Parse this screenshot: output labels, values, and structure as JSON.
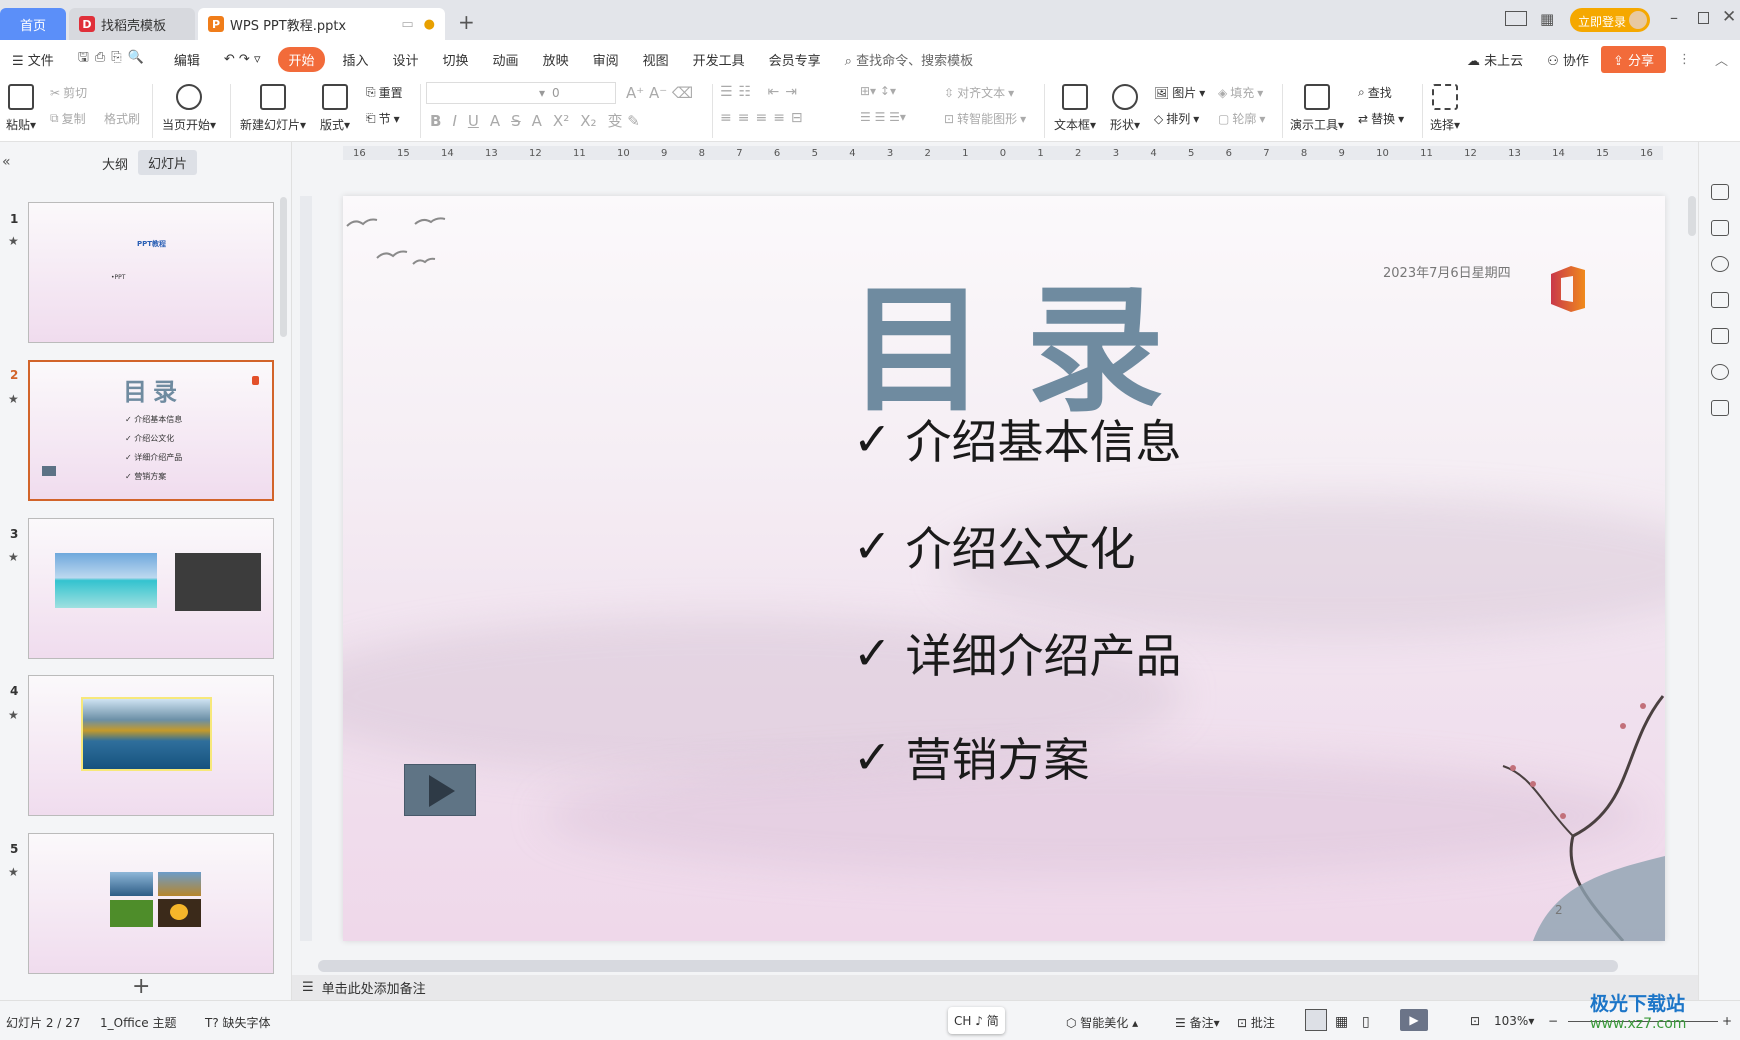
{
  "titlebar": {
    "tabs": [
      {
        "label": "首页"
      },
      {
        "label": "找稻壳模板"
      },
      {
        "label": "WPS PPT教程.pptx"
      }
    ],
    "new_tab": "+",
    "login": "立即登录",
    "colors": {
      "home_tab": "#5b8ff9",
      "accent": "#f26b3a",
      "login": "#f5a800"
    }
  },
  "menubar": {
    "file": "文件",
    "edit": "编辑",
    "tabs": [
      "开始",
      "插入",
      "设计",
      "切换",
      "动画",
      "放映",
      "审阅",
      "视图",
      "开发工具",
      "会员专享"
    ],
    "active": "开始",
    "search_placeholder": "查找命令、搜索模板",
    "cloud": "未上云",
    "collab": "协作",
    "share": "分享"
  },
  "ribbon": {
    "paste": "粘贴",
    "cut": "剪切",
    "copy": "复制",
    "format_painter": "格式刷",
    "play_current": "当页开始",
    "new_slide": "新建幻灯片",
    "layout": "版式",
    "reset": "重置",
    "section": "节",
    "font_size": "0",
    "align_text": "对齐文本",
    "smartart": "转智能图形",
    "textbox": "文本框",
    "shape": "形状",
    "picture": "图片",
    "fill": "填充",
    "arrange": "排列",
    "outline": "轮廓",
    "present_tools": "演示工具",
    "find": "查找",
    "replace": "替换",
    "select": "选择",
    "format_buttons": [
      "B",
      "I",
      "U",
      "A",
      "S",
      "A",
      "X²",
      "X₂"
    ]
  },
  "leftpanel": {
    "tab_outline": "大纲",
    "tab_slides": "幻灯片",
    "add": "+",
    "slides": [
      {
        "num": "1",
        "title": "PPT教程",
        "sub": "•PPT"
      },
      {
        "num": "2",
        "title": "目录",
        "items": [
          "✓ 介绍基本信息",
          "✓ 介绍公文化",
          "✓ 详细介绍产品",
          "✓ 营销方案"
        ]
      },
      {
        "num": "3"
      },
      {
        "num": "4"
      },
      {
        "num": "5"
      }
    ],
    "selected": 2
  },
  "ruler": {
    "ticks": [
      "16",
      "15",
      "14",
      "13",
      "12",
      "11",
      "10",
      "9",
      "8",
      "7",
      "6",
      "5",
      "4",
      "3",
      "2",
      "1",
      "0",
      "1",
      "2",
      "3",
      "4",
      "5",
      "6",
      "7",
      "8",
      "9",
      "10",
      "11",
      "12",
      "13",
      "14",
      "15",
      "16"
    ]
  },
  "slide": {
    "title": "目录",
    "date": "2023年7月6日星期四",
    "bullets": [
      "介绍基本信息",
      "介绍公文化",
      "详细介绍产品",
      "营销方案"
    ],
    "check": "✓",
    "page_number": "2"
  },
  "notes": {
    "placeholder": "单击此处添加备注"
  },
  "statusbar": {
    "slide_info": "幻灯片 2 / 27",
    "theme": "1_Office 主题",
    "missing_font": "缺失字体",
    "ime": "CH ♪ 简",
    "beautify": "智能美化",
    "notes": "备注",
    "comments": "批注",
    "zoom": "103%"
  },
  "watermark": {
    "text": "极光下载站",
    "url": "www.xz7.com"
  }
}
